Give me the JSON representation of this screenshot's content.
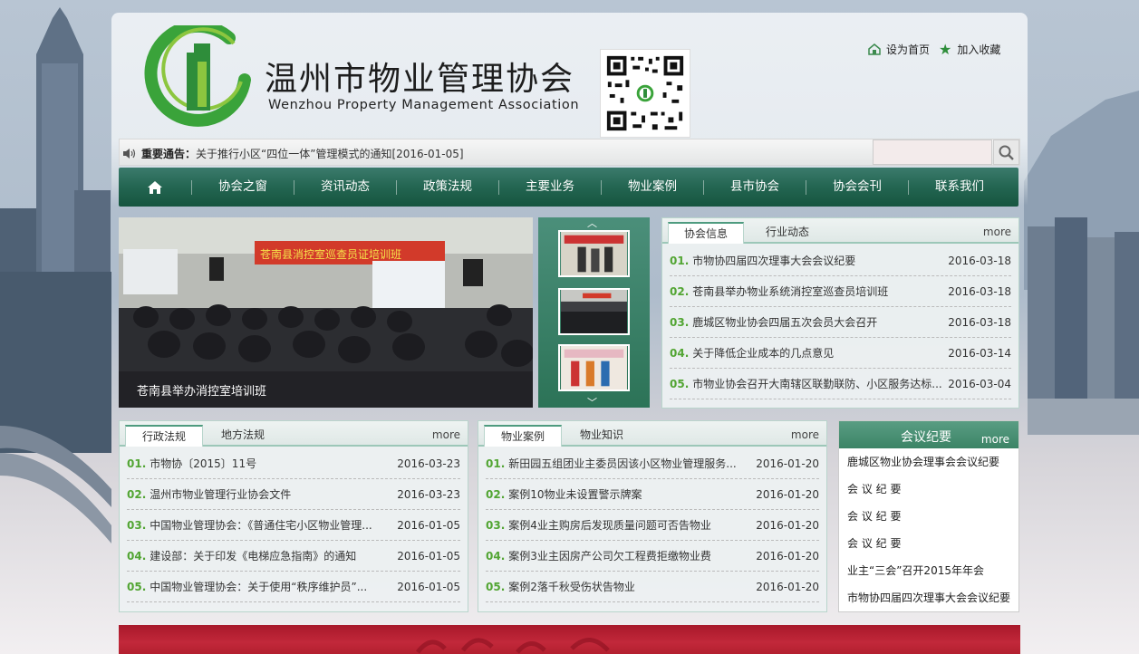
{
  "header": {
    "site_title": "温州市物业管理协会",
    "site_subtitle": "Wenzhou Property Management Association",
    "set_home": "设为首页",
    "bookmark": "加入收藏"
  },
  "notice": {
    "label": "重要通告：",
    "text": "关于推行小区“四位一体”管理模式的通知[2016-01-05]"
  },
  "search": {
    "placeholder": ""
  },
  "nav": {
    "items": [
      "协会之窗",
      "资讯动态",
      "政策法规",
      "主要业务",
      "物业案例",
      "县市协会",
      "协会会刊",
      "联系我们"
    ]
  },
  "slideshow": {
    "caption": "苍南县举办消控室培训班",
    "banner_text": "苍南县消控室巡查员证培训班"
  },
  "news_panel": {
    "tabs": [
      "协会信息",
      "行业动态"
    ],
    "more": "more",
    "items": [
      {
        "num": "01.",
        "title": "市物协四届四次理事大会会议纪要",
        "date": "2016-03-18"
      },
      {
        "num": "02.",
        "title": "苍南县举办物业系统消控室巡查员培训班",
        "date": "2016-03-18"
      },
      {
        "num": "03.",
        "title": "鹿城区物业协会四届五次会员大会召开",
        "date": "2016-03-18"
      },
      {
        "num": "04.",
        "title": "关于降低企业成本的几点意见",
        "date": "2016-03-14"
      },
      {
        "num": "05.",
        "title": "市物业协会召开大南辖区联勤联防、小区服务达标...",
        "date": "2016-03-04"
      }
    ]
  },
  "law_panel": {
    "tabs": [
      "行政法规",
      "地方法规"
    ],
    "more": "more",
    "items": [
      {
        "num": "01.",
        "title": "市物协〔2015〕11号",
        "date": "2016-03-23"
      },
      {
        "num": "02.",
        "title": "温州市物业管理行业协会文件",
        "date": "2016-03-23"
      },
      {
        "num": "03.",
        "title": "中国物业管理协会：《普通住宅小区物业管理...",
        "date": "2016-01-05"
      },
      {
        "num": "04.",
        "title": "建设部：关于印发《电梯应急指南》的通知",
        "date": "2016-01-05"
      },
      {
        "num": "05.",
        "title": "中国物业管理协会：关于使用“秩序维护员”...",
        "date": "2016-01-05"
      }
    ]
  },
  "case_panel": {
    "tabs": [
      "物业案例",
      "物业知识"
    ],
    "more": "more",
    "items": [
      {
        "num": "01.",
        "title": "新田园五组团业主委员因该小区物业管理服务...",
        "date": "2016-01-20"
      },
      {
        "num": "02.",
        "title": "案例10物业未设置警示牌案",
        "date": "2016-01-20"
      },
      {
        "num": "03.",
        "title": "案例4业主购房后发现质量问题可否告物业",
        "date": "2016-01-20"
      },
      {
        "num": "04.",
        "title": "案例3业主因房产公司欠工程费拒缴物业费",
        "date": "2016-01-20"
      },
      {
        "num": "05.",
        "title": "案例2落千秋受伤状告物业",
        "date": "2016-01-20"
      }
    ]
  },
  "minutes_panel": {
    "title": "会议纪要",
    "more": "more",
    "items": [
      "鹿城区物业协会理事会会议纪要",
      "会 议 纪 要",
      "会 议 纪 要",
      "会 议 纪 要",
      "业主“三会”召开2015年年会",
      "市物协四届四次理事大会会议纪要"
    ]
  },
  "colors": {
    "nav_green": "#236551",
    "accent_green": "#52a533",
    "banner_red": "#b3202f"
  }
}
